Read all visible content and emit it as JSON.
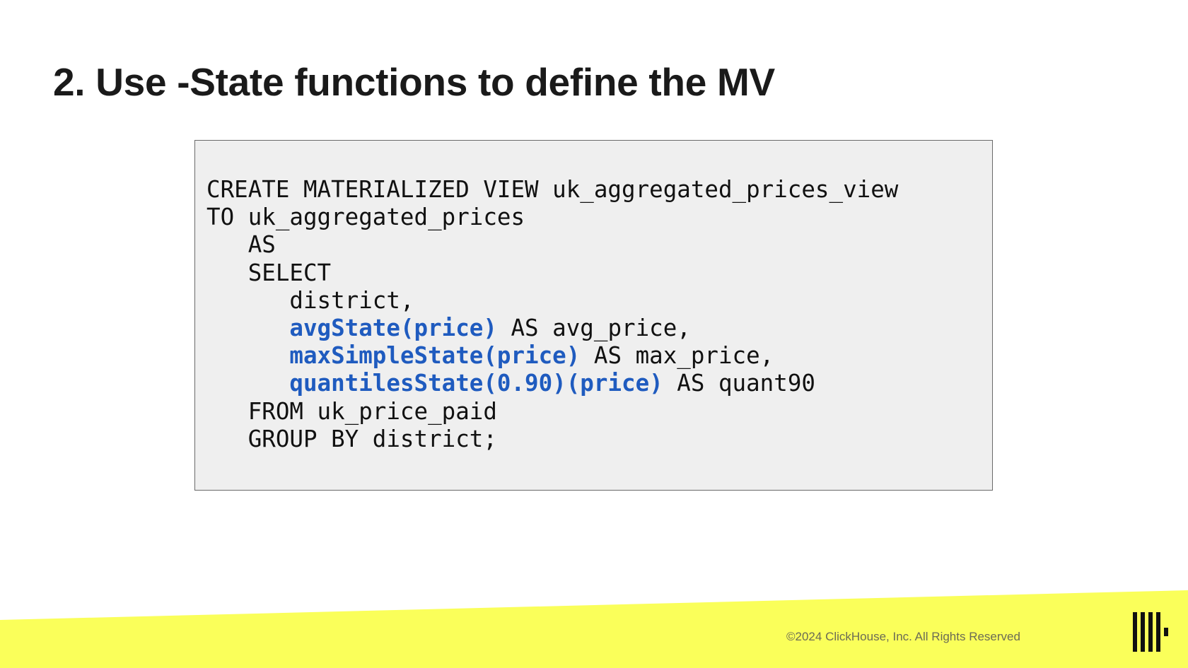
{
  "slide": {
    "title": "2. Use -State functions to define the MV",
    "code_lines": [
      {
        "indent": "",
        "segments": [
          {
            "text": "CREATE MATERIALIZED VIEW uk_aggregated_prices_view",
            "highlight": false
          }
        ]
      },
      {
        "indent": "",
        "segments": [
          {
            "text": "TO uk_aggregated_prices",
            "highlight": false
          }
        ]
      },
      {
        "indent": "   ",
        "segments": [
          {
            "text": "AS",
            "highlight": false
          }
        ]
      },
      {
        "indent": "   ",
        "segments": [
          {
            "text": "SELECT",
            "highlight": false
          }
        ]
      },
      {
        "indent": "      ",
        "segments": [
          {
            "text": "district,",
            "highlight": false
          }
        ]
      },
      {
        "indent": "      ",
        "segments": [
          {
            "text": "avgState(price)",
            "highlight": true
          },
          {
            "text": " AS avg_price,",
            "highlight": false
          }
        ]
      },
      {
        "indent": "      ",
        "segments": [
          {
            "text": "maxSimpleState(price)",
            "highlight": true
          },
          {
            "text": " AS max_price,",
            "highlight": false
          }
        ]
      },
      {
        "indent": "      ",
        "segments": [
          {
            "text": "quantilesState(0.90)(price)",
            "highlight": true
          },
          {
            "text": " AS quant90",
            "highlight": false
          }
        ]
      },
      {
        "indent": "   ",
        "segments": [
          {
            "text": "FROM uk_price_paid",
            "highlight": false
          }
        ]
      },
      {
        "indent": "   ",
        "segments": [
          {
            "text": "GROUP BY district;",
            "highlight": false
          }
        ]
      }
    ]
  },
  "footer": {
    "copyright": "©2024 ClickHouse, Inc. All Rights Reserved",
    "logo_icon": "clickhouse-logo-icon"
  },
  "colors": {
    "highlight_function": "#1f5bbf",
    "code_background": "#efefef",
    "footer_band": "#faff5a",
    "title": "#1a1a1a"
  }
}
